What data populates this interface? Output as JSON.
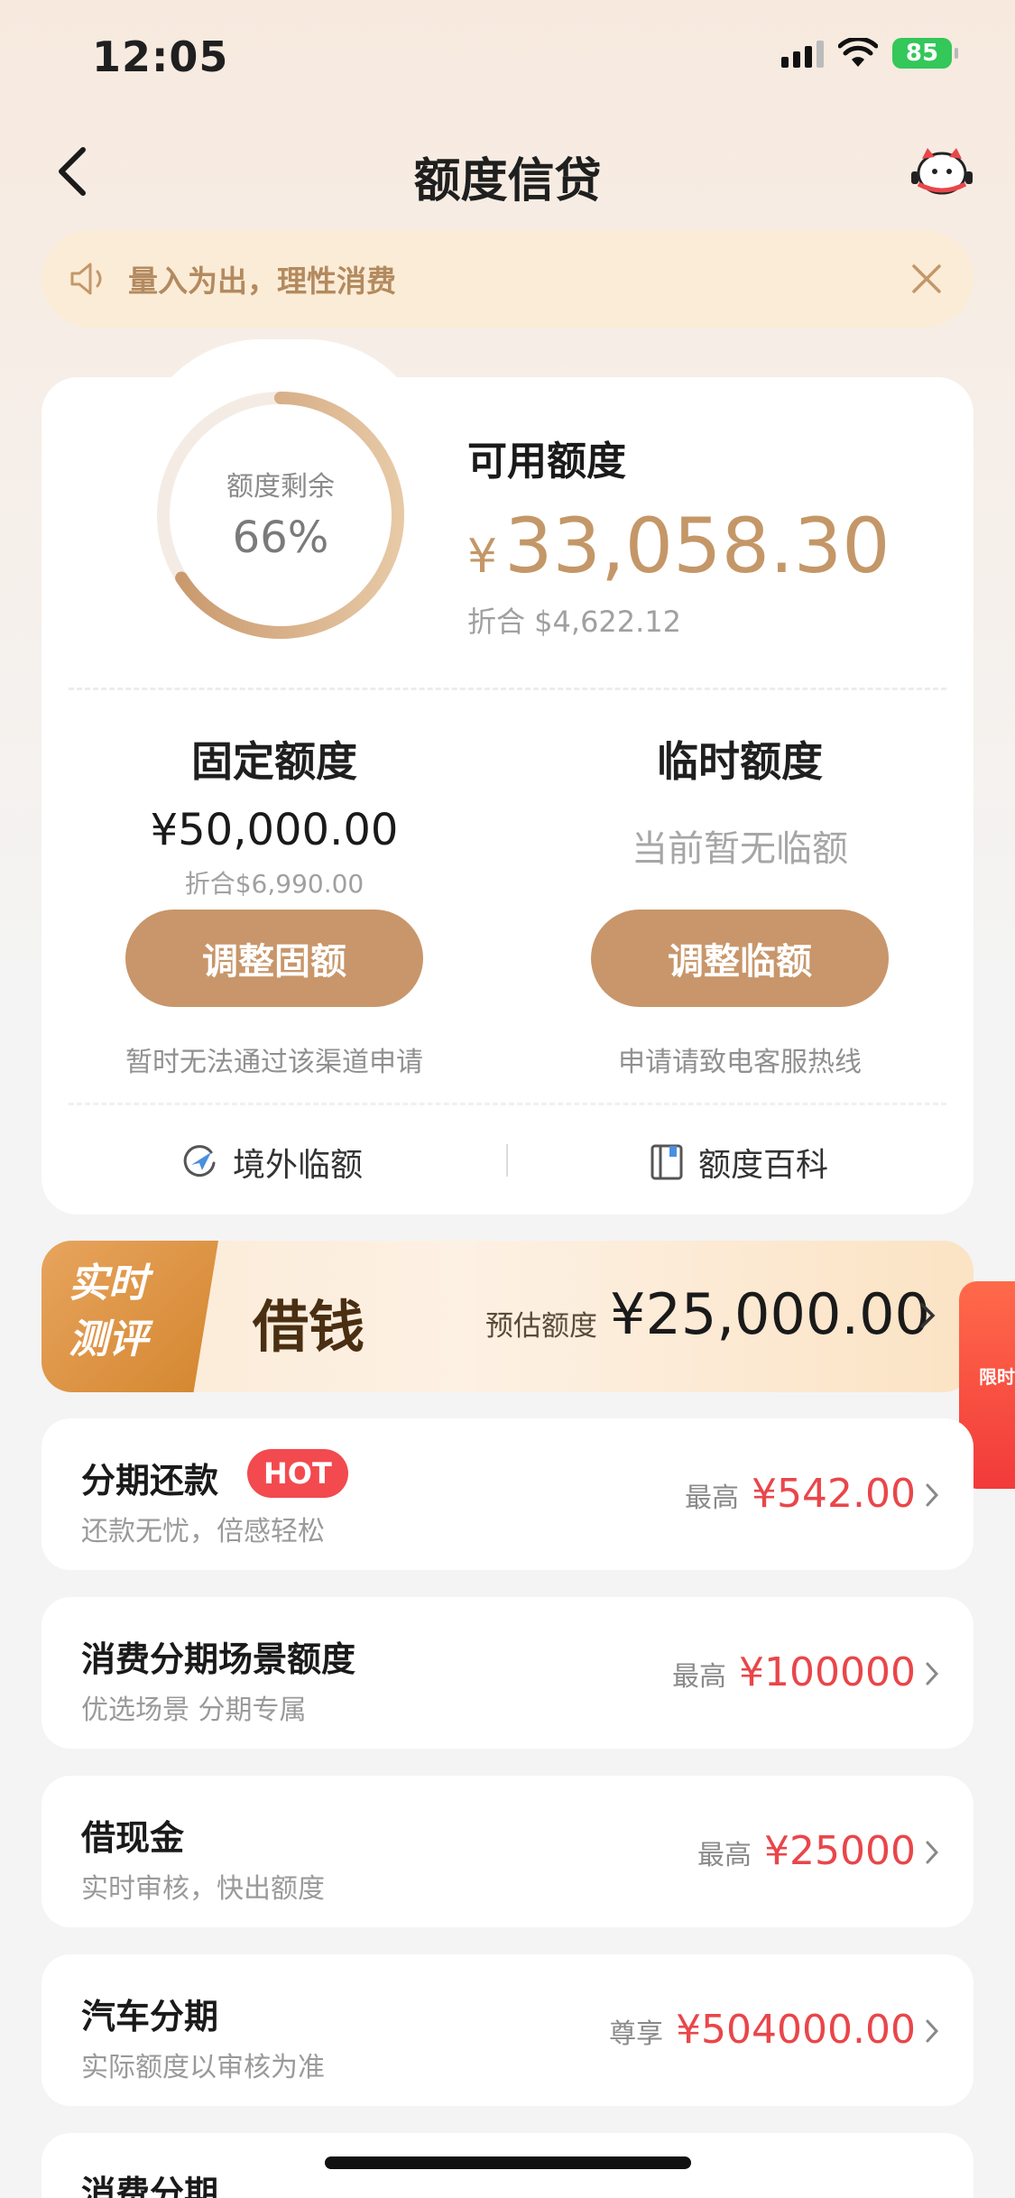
{
  "status_bar": {
    "time": "12:05",
    "battery": "85"
  },
  "header": {
    "title": "额度信贷"
  },
  "notice": {
    "text": "量入为出，理性消费"
  },
  "credit_card": {
    "ring_label": "额度剩余",
    "ring_percent": "66%",
    "ring_fraction": 0.66,
    "available_label": "可用额度",
    "available_currency": "¥",
    "available_amount": "33,058.30",
    "available_converted": "折合 $4,622.12",
    "fixed": {
      "title": "固定额度",
      "amount": "¥50,000.00",
      "converted": "折合$6,990.00",
      "button": "调整固额",
      "note": "暂时无法通过该渠道申请"
    },
    "temporary": {
      "title": "临时额度",
      "status": "当前暂无临额",
      "button": "调整临额",
      "note": "申请请致电客服热线"
    },
    "tools": [
      {
        "label": "境外临额",
        "icon": "globe-plane-icon"
      },
      {
        "label": "额度百科",
        "icon": "book-icon"
      }
    ]
  },
  "loan_banner": {
    "badge_line1": "实时",
    "badge_line2": "测评",
    "title": "借钱",
    "estimate_label": "预估额度",
    "estimate_amount": "¥25,000.00"
  },
  "float_promo": {
    "text": "限时"
  },
  "products": [
    {
      "title": "分期还款",
      "badge": "HOT",
      "subtitle": "还款无忧，倍感轻松",
      "prefix": "最高",
      "value": "¥542.00"
    },
    {
      "title": "消费分期场景额度",
      "subtitle": "优选场景 分期专属",
      "prefix": "最高",
      "value": "¥100000"
    },
    {
      "title": "借现金",
      "subtitle": "实时审核，快出额度",
      "prefix": "最高",
      "value": "¥25000"
    },
    {
      "title": "汽车分期",
      "subtitle": "实际额度以审核为准",
      "prefix": "尊享",
      "value": "¥504000.00"
    },
    {
      "title": "消费分期"
    }
  ],
  "colors": {
    "accent": "#c8966a",
    "red": "#e9464a",
    "notice_bg": "#fbecd7"
  }
}
